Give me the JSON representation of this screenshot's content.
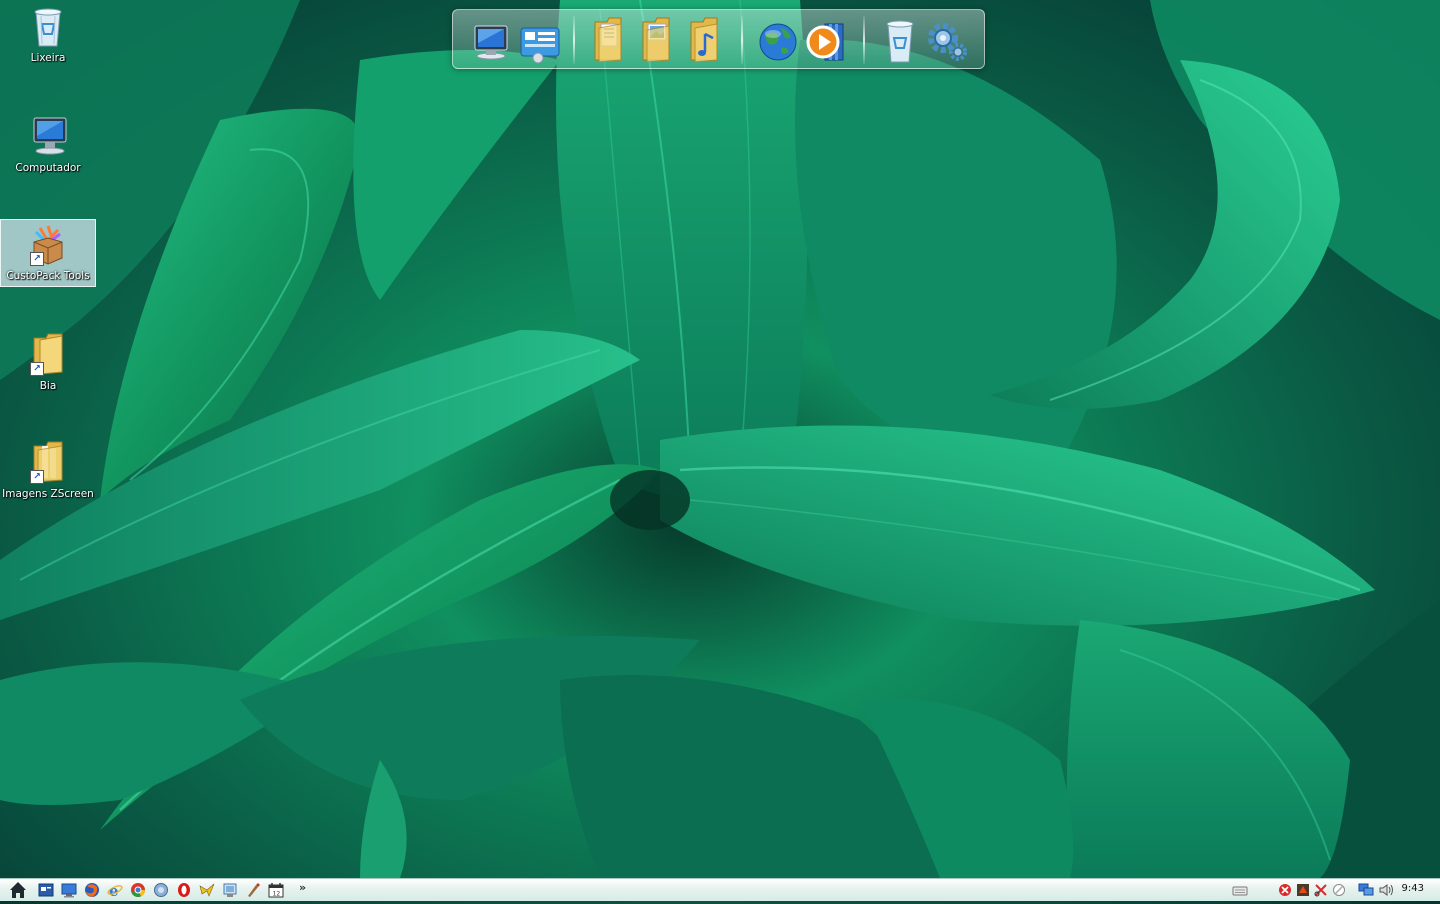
{
  "desktop": {
    "icons": [
      {
        "label": "Lixeira",
        "icon": "recycle-bin-icon"
      },
      {
        "label": "Computador",
        "icon": "computer-icon"
      },
      {
        "label": "CustoPack Tools",
        "icon": "package-icon",
        "shortcut": true,
        "selected": true
      },
      {
        "label": "Bia",
        "icon": "folder-icon",
        "shortcut": true
      },
      {
        "label": "Imagens ZScreen",
        "icon": "folder-icon",
        "shortcut": true
      }
    ]
  },
  "dock": {
    "items": [
      "computer-icon",
      "control-panel-icon",
      "documents-folder-icon",
      "pictures-folder-icon",
      "music-folder-icon",
      "internet-globe-icon",
      "media-player-icon",
      "recycle-bin-icon",
      "settings-gears-icon"
    ]
  },
  "taskbar": {
    "quick_launch": [
      "home-icon",
      "window-icon",
      "desktop-icon",
      "firefox-icon",
      "internet-explorer-icon",
      "chrome-icon",
      "browser-icon",
      "opera-icon",
      "messenger-icon",
      "network-icon",
      "paint-icon",
      "calendar-icon"
    ],
    "overflow_label": "»",
    "tray": [
      "keyboard-icon",
      "error-icon",
      "alert-icon",
      "scissors-icon",
      "block-icon",
      "network-icon",
      "volume-icon"
    ],
    "clock": "9:43"
  },
  "colors": {
    "taskbar_bg": "#e8f3f0",
    "leaf_green": "#17a774",
    "leaf_dark": "#0a5a44"
  }
}
